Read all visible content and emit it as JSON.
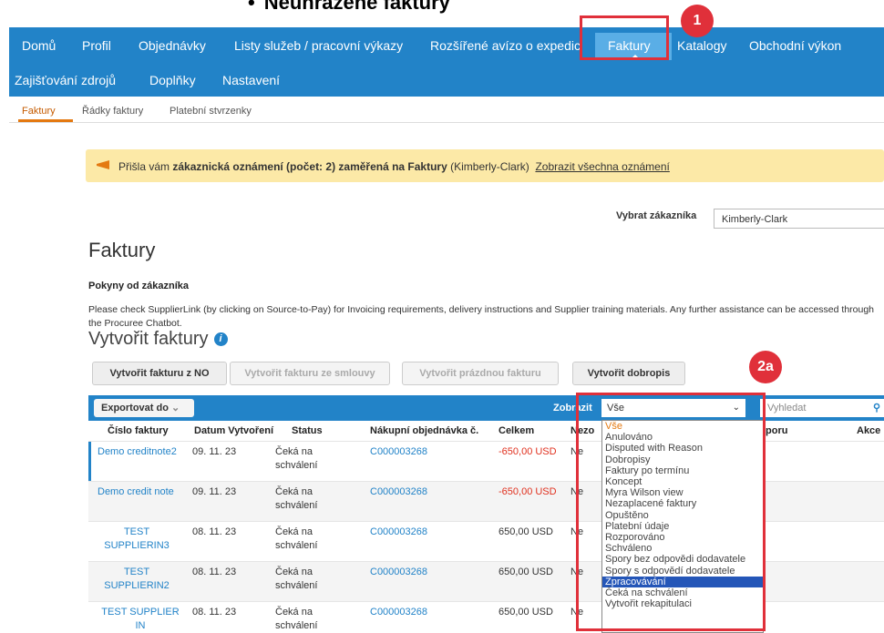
{
  "slide_title": "Neuhrazené faktury",
  "nav": {
    "row1": [
      "Domů",
      "Profil",
      "Objednávky",
      "Listy služeb / pracovní výkazy",
      "Rozšířené avízo o expedici",
      "Faktury",
      "Katalogy",
      "Obchodní výkon"
    ],
    "row2": [
      "Zajišťování zdrojů",
      "Doplňky",
      "Nastavení"
    ],
    "active": "Faktury"
  },
  "subnav": [
    "Faktury",
    "Řádky faktury",
    "Platební stvrzenky"
  ],
  "notice": {
    "pre": "Přišla vám ",
    "bold": "zákaznická oznámení (počet: 2) zaměřená na Faktury",
    "post": " (Kimberly-Clark)",
    "link": "Zobrazit všechna oznámení"
  },
  "customer": {
    "label": "Vybrat zákazníka",
    "value": "Kimberly-Clark"
  },
  "page_title": "Faktury",
  "instructions": {
    "title": "Pokyny od zákazníka",
    "text": "Please check SupplierLink (by clicking on Source-to-Pay) for Invoicing requirements, delivery instructions and Supplier training materials. Any further assistance can be accessed through the Procuree Chatbot."
  },
  "create": {
    "title": "Vytvořit faktury",
    "buttons": [
      "Vytvořit fakturu z NO",
      "Vytvořit fakturu ze smlouvy",
      "Vytvořit prázdnou fakturu",
      "Vytvořit dobropis"
    ]
  },
  "toolbar": {
    "export": "Exportovat do",
    "show_label": "Zobrazit",
    "filter_value": "Vše",
    "search_placeholder": "Vyhledat"
  },
  "columns": [
    "Číslo faktury",
    "Datum Vytvoření",
    "Status",
    "Nákupní objednávka č.",
    "Celkem",
    "Nezo",
    "poru",
    "Akce"
  ],
  "rows": [
    {
      "number": "Demo creditnote2",
      "date": "09. 11. 23",
      "status": "Čeká na schválení",
      "po": "C000003268",
      "total": "-650,00 USD",
      "nezo": "Ne"
    },
    {
      "number": "Demo credit note",
      "date": "09. 11. 23",
      "status": "Čeká na schválení",
      "po": "C000003268",
      "total": "-650,00 USD",
      "nezo": "Ne"
    },
    {
      "number": "TEST SUPPLIERIN3",
      "date": "08. 11. 23",
      "status": "Čeká na schválení",
      "po": "C000003268",
      "total": "650,00 USD",
      "nezo": "Ne"
    },
    {
      "number": "TEST SUPPLIERIN2",
      "date": "08. 11. 23",
      "status": "Čeká na schválení",
      "po": "C000003268",
      "total": "650,00 USD",
      "nezo": "Ne"
    },
    {
      "number": "TEST SUPPLIER IN",
      "date": "08. 11. 23",
      "status": "Čeká na schválení",
      "po": "C000003268",
      "total": "650,00 USD",
      "nezo": "Ne"
    }
  ],
  "filter_options": [
    "Vše",
    "Anulováno",
    "Disputed with Reason",
    "Dobropisy",
    "Faktury po termínu",
    "Koncept",
    "Myra Wilson view",
    "Nezaplacené faktury",
    "Opuštěno",
    "Platební údaje",
    "Rozporováno",
    "Schváleno",
    "Spory bez odpovědi dodavatele",
    "Spory s odpovědí dodavatele",
    "Zpracovávání",
    "Čeká na schválení",
    "Vytvořit rekapitulaci"
  ],
  "selected_option": "Zpracovávání",
  "badges": [
    "1",
    "2a"
  ],
  "colors": {
    "nav": "#2283c8",
    "accent": "#e47911",
    "callout": "#e0303a",
    "link": "#2283c8"
  }
}
